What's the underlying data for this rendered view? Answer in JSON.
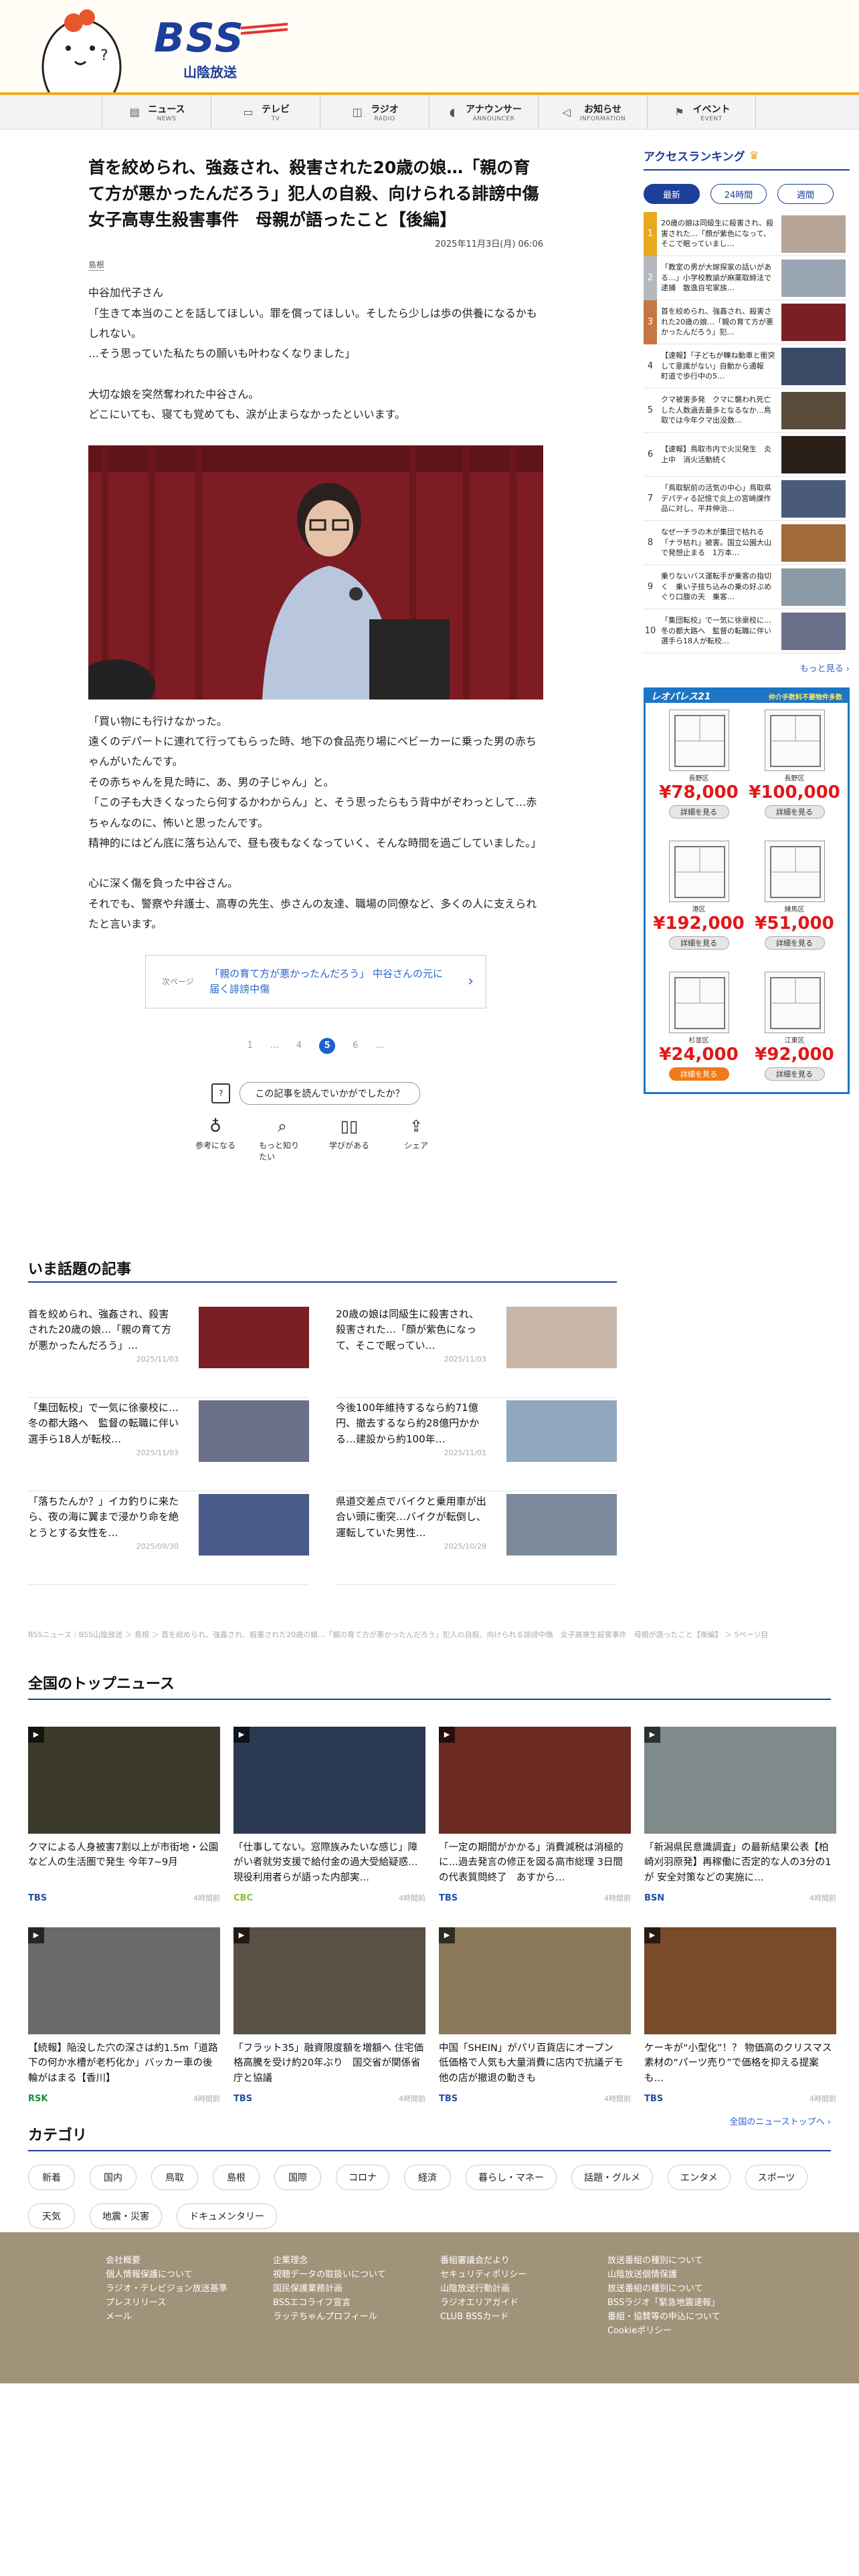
{
  "header": {
    "logo_text": "BSS",
    "logo_sub": "山陰放送",
    "nav": [
      {
        "jp": "ニュース",
        "en": "NEWS",
        "icon": "news-icon",
        "glyph": "▤"
      },
      {
        "jp": "テレビ",
        "en": "TV",
        "icon": "tv-icon",
        "glyph": "▭"
      },
      {
        "jp": "ラジオ",
        "en": "RADIO",
        "icon": "radio-icon",
        "glyph": "◫"
      },
      {
        "jp": "アナウンサー",
        "en": "ANNOUNCER",
        "icon": "microphone-icon",
        "glyph": "◖"
      },
      {
        "jp": "お知らせ",
        "en": "INFORMATION",
        "icon": "megaphone-icon",
        "glyph": "◁"
      },
      {
        "jp": "イベント",
        "en": "EVENT",
        "icon": "flag-icon",
        "glyph": "⚑"
      }
    ]
  },
  "article": {
    "headline": "首を絞められ、強姦され、殺害された20歳の娘…「親の育て方が悪かったんだろう」犯人の自殺、向けられる誹謗中傷　女子高専生殺害事件　母親が語ったこと【後編】",
    "date": "2025年11月3日(月) 06:06",
    "region": "島根",
    "paragraphs_1": [
      "中谷加代子さん\n「生きて本当のことを話してほしい。罪を償ってほしい。そしたら少しは歩の供養になるかもしれない。\n…そう思っていた私たちの願いも叶わなくなりました」",
      "大切な娘を突然奪われた中谷さん。\nどこにいても、寝ても覚めても、涙が止まらなかったといいます。"
    ],
    "paragraphs_2": [
      "「買い物にも行けなかった。\n遠くのデパートに連れて行ってもらった時、地下の食品売り場にベビーカーに乗った男の赤ちゃんがいたんです。\nその赤ちゃんを見た時に、あ、男の子じゃん」と。\n「この子も大きくなったら何するかわからん」と、そう思ったらもう背中がぞわっとして…赤ちゃんなのに、怖いと思ったんです。\n精神的にはどん底に落ち込んで、昼も夜もなくなっていく、そんな時間を過ごしていました。」",
      "心に深く傷を負った中谷さん。\nそれでも、警察や弁護士、高専の先生、歩さんの友達、職場の同僚など、多くの人に支えられたと言います。"
    ],
    "next_label": "次ページ",
    "next_title": "「親の育て方が悪かったんだろう」 中谷さんの元に届く誹謗中傷",
    "pager": [
      "1",
      "…",
      "4",
      "5",
      "6",
      "…"
    ],
    "pager_current": "5",
    "feedback_question": "この記事を読んでいかがでしたか？",
    "feedback_icon_text": "?",
    "reactions": [
      {
        "label": "参考になる",
        "icon": "lightbulb-icon",
        "glyph": "♁"
      },
      {
        "label": "もっと知りたい",
        "icon": "search-icon",
        "glyph": "⌕"
      },
      {
        "label": "学びがある",
        "icon": "book-icon",
        "glyph": "▯▯"
      },
      {
        "label": "シェア",
        "icon": "share-icon",
        "glyph": "⇪"
      }
    ]
  },
  "trending": {
    "title": "いま話題の記事",
    "items": [
      {
        "title": "首を絞められ、強姦され、殺害された20歳の娘…「親の育て方が悪かったんだろう」…",
        "date": "2025/11/03",
        "thumb": "#7a1f26"
      },
      {
        "title": "20歳の娘は同級生に殺害され、殺害された…「顔が紫色になって、そこで眠ってい…",
        "date": "2025/11/03",
        "thumb": "#c8b6a8"
      },
      {
        "title": "「集団転校」で一気に徐豪校に…冬の都大路へ　監督の転職に伴い選手ら18人が転校…",
        "date": "2025/11/03",
        "thumb": "#6a6f8a"
      },
      {
        "title": "今後100年維持するなら約71億円、撤去するなら約28億円かかる…建設から約100年…",
        "date": "2025/11/01",
        "thumb": "#8fa7bf"
      },
      {
        "title": "「落ちたんか？」イカ釣りに来たら、夜の海に翼まで浸かり命を絶とうとする女性を…",
        "date": "2025/09/30",
        "thumb": "#4a5a8a"
      },
      {
        "title": "県道交差点でバイクと乗用車が出合い頭に衝突…バイクが転倒し、運転していた男性…",
        "date": "2025/10/29",
        "thumb": "#7a8a9a"
      }
    ]
  },
  "breadcrumb": "BSSニュース｜BSS山陰放送 ＞ 島根 ＞ 首を絞められ、強姦され、殺害された20歳の娘…「親の育て方が悪かったんだろう」犯人の自殺、向けられる誹謗中傷　女子高専生殺害事件　母親が語ったこと【後編】 ＞ 5ページ目",
  "top_news": {
    "title": "全国のトップニュース",
    "items": [
      {
        "caption": "クマによる人身被害7割以上が市街地・公園など人の生活圏で発生 今年7~9月",
        "source": "TBS",
        "time": "4時間前",
        "src_color": "#1f4fa8",
        "img": "#3b3a2a"
      },
      {
        "caption": "「仕事してない。窓際族みたいな感じ」障がい者就労支援で給付金の過大受給疑惑…現役利用者らが語った内部実…",
        "source": "CBC",
        "time": "4時間前",
        "src_color": "#8bbf2a",
        "img": "#2a3a52"
      },
      {
        "caption": "「一定の期間がかかる」消費減税は消極的に…過去発言の修正を図る高市総理 3日間の代表質問終了　あすから…",
        "source": "TBS",
        "time": "4時間前",
        "src_color": "#1f4fa8",
        "img": "#6b2a22"
      },
      {
        "caption": "「新潟県民意識調査」の最新結果公表【柏崎刈羽原発】再稼働に否定的な人の3分の1が 安全対策などの実施に…",
        "source": "BSN",
        "time": "4時間前",
        "src_color": "#1f4fa8",
        "img": "#7f8a8a"
      },
      {
        "caption": "【続報】陥没した穴の深さは約1.5m「道路下の何か水槽が老朽化か」バッカー車の後輪がはまる【香川】",
        "source": "RSK",
        "time": "4時間前",
        "src_color": "#1e8a3a",
        "img": "#6a6a6a"
      },
      {
        "caption": "「フラット35」融資限度額を増額へ 住宅価格高騰を受け約20年ぶり　国交省が関係省庁と協議",
        "source": "TBS",
        "time": "4時間前",
        "src_color": "#1f4fa8",
        "img": "#5a5046"
      },
      {
        "caption": "中国「SHEIN」がパリ百貨店にオープン　低価格で人気も大量消費に店内で抗議デモ他の店が撤退の動きも",
        "source": "TBS",
        "time": "4時間前",
        "src_color": "#1f4fa8",
        "img": "#8a7a5a"
      },
      {
        "caption": "ケーキが“小型化”！？ 物価高のクリスマス　素材の“パーツ売り”で価格を抑える提案も…",
        "source": "TBS",
        "time": "4時間前",
        "src_color": "#1f4fa8",
        "img": "#7a4a2a"
      }
    ],
    "more": "全国のニューストップへ ›"
  },
  "categories": {
    "title": "カテゴリ",
    "items": [
      "新着",
      "国内",
      "鳥取",
      "島根",
      "国際",
      "コロナ",
      "経済",
      "暮らし・マネー",
      "話題・グルメ",
      "エンタメ",
      "スポーツ",
      "天気",
      "地震・災害",
      "ドキュメンタリー"
    ]
  },
  "footer": {
    "cols": [
      [
        "会社概要",
        "個人情報保護について",
        "ラジオ・テレビジョン放送基準",
        "プレスリリース",
        "メール"
      ],
      [
        "企業理念",
        "視聴データの取扱いについて",
        "国民保護業務計画",
        "BSSエコライフ宣言",
        "ラッテちゃんプロフィール"
      ],
      [
        "番組審議会だより",
        "セキュリティポリシー",
        "山陰放送行動計画",
        "ラジオエリアガイド",
        "CLUB BSSカード"
      ],
      [
        "放送番組の種別について",
        "山陰放送個情保護",
        "放送番組の種別について",
        "BSSラジオ「緊急地震速報」",
        "番組・協賛等の申込について",
        "Cookieポリシー"
      ]
    ]
  },
  "sidebar": {
    "ranking_title": "アクセスランキング",
    "crown_glyph": "♛",
    "tabs": [
      "最新",
      "24時間",
      "週間"
    ],
    "active_tab": 0,
    "items": [
      {
        "rank": "1",
        "text": "20歳の娘は同級生に殺害され、殺害された…「顔が紫色になって、そこで眠っていまし…",
        "img": "#b7a598"
      },
      {
        "rank": "2",
        "text": "「教室の男が大嫁探家の話いがある…」小学校教諭が麻薬取締法で逮捕　散逸自宅家族…",
        "img": "#9aa6b4"
      },
      {
        "rank": "3",
        "text": "首を絞められ、強姦され、殺害された20歳の娘…「親の育て方が悪かったんだろう」犯…",
        "img": "#7a1f26"
      },
      {
        "rank": "4",
        "text": "【速報】「子どもが轢ね動車と衝突して意識がない」自動から通報　町道で歩行中の5…",
        "img": "#3a4a66"
      },
      {
        "rank": "5",
        "text": "クマ被害多発　クマに襲われ死亡した人数過去最多となるなか…鳥取では今年クマ出没数…",
        "img": "#5a4a3a"
      },
      {
        "rank": "6",
        "text": "【速報】鳥取市内で火災発生　炎上中　消火活動続く",
        "img": "#2a2018"
      },
      {
        "rank": "7",
        "text": "「鳥取駅前の活気の中心」鳥取県デパティる記憶で炎上の宮崎課作品に対し、平井伸治…",
        "img": "#4a5a7a"
      },
      {
        "rank": "8",
        "text": "なぜ一チラの木が集団で枯れる「ナラ枯れ」被害。国立公園大山で発想止まる　1万本…",
        "img": "#a06a3a"
      },
      {
        "rank": "9",
        "text": "乗りないバス運転手が乗客の指切く　乗い子技ち込みの乗の好ぶめぐり口腹の天　乗客…",
        "img": "#8a9aa6"
      },
      {
        "rank": "10",
        "text": "「集団転校」で一気に徐豪校に…冬の都大路へ　監督の転職に伴い選手ら18人が転校…",
        "img": "#6a6f8a"
      }
    ],
    "more": "もっと見る ›",
    "ad": {
      "brand": "レオパレス21",
      "tagline": "仲介手数料不要物件多数",
      "cards": [
        {
          "area": "長野区",
          "price": "¥78,000",
          "btn": "詳細を見る",
          "hot": false
        },
        {
          "area": "長野区",
          "price": "¥100,000",
          "btn": "詳細を見る",
          "hot": false
        },
        {
          "area": "港区",
          "price": "¥192,000",
          "btn": "詳細を見る",
          "hot": false
        },
        {
          "area": "練馬区",
          "price": "¥51,000",
          "btn": "詳細を見る",
          "hot": false
        },
        {
          "area": "杉並区",
          "price": "¥24,000",
          "btn": "詳細を見る",
          "hot": true
        },
        {
          "area": "江東区",
          "price": "¥92,000",
          "btn": "詳細を見る",
          "hot": false
        }
      ]
    }
  }
}
